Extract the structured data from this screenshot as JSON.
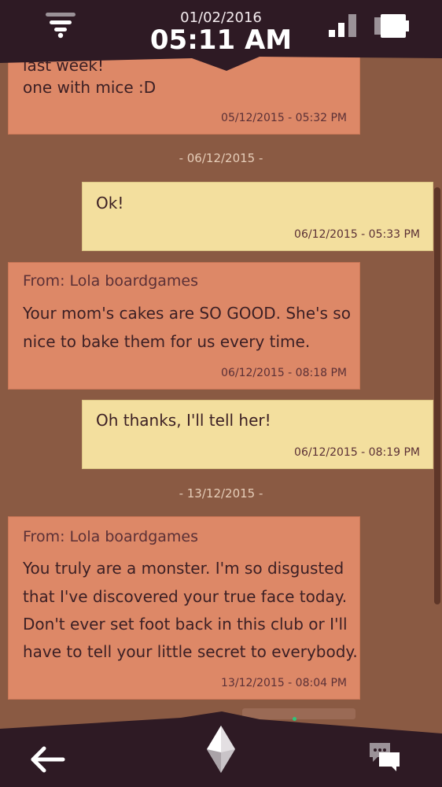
{
  "status_bar": {
    "date": "01/02/2016",
    "time": "05:11 AM"
  },
  "messages": [
    {
      "direction": "incoming",
      "lines": [
        "last week! ",
        "one with mice :D"
      ],
      "timestamp": "05/12/2015 - 05:32 PM"
    },
    {
      "date_separator": "- 06/12/2015 -"
    },
    {
      "direction": "outgoing",
      "lines": [
        "Ok!"
      ],
      "timestamp": "06/12/2015 - 05:33 PM"
    },
    {
      "direction": "incoming",
      "from": "From: Lola boardgames",
      "lines": [
        "Your mom's cakes are SO GOOD. She's so",
        "nice to bake them for us every time."
      ],
      "timestamp": "06/12/2015 - 08:18 PM"
    },
    {
      "direction": "outgoing",
      "lines": [
        "Oh thanks, I'll tell her!"
      ],
      "timestamp": "06/12/2015 - 08:19 PM"
    },
    {
      "date_separator": "- 13/12/2015 -"
    },
    {
      "direction": "incoming",
      "from": "From: Lola boardgames",
      "lines": [
        "You truly are a monster. I'm so disgusted",
        "that I've discovered your true face today.",
        "Don't ever set foot back in this club or I'll",
        "have to tell your little secret to everybody."
      ],
      "timestamp": "13/12/2015 - 08:04 PM"
    }
  ],
  "icons": {
    "wifi": "wifi-icon",
    "signal": "signal-icon",
    "battery": "battery-icon",
    "back": "back-arrow-icon",
    "home": "crystal-home-icon",
    "messages": "chat-bubbles-icon"
  },
  "colors": {
    "bar_background": "#2e1a24",
    "chat_background": "#8a5a43",
    "incoming_bubble": "#dd8867",
    "outgoing_bubble": "#f3df9e",
    "message_text": "#3b1f24"
  }
}
